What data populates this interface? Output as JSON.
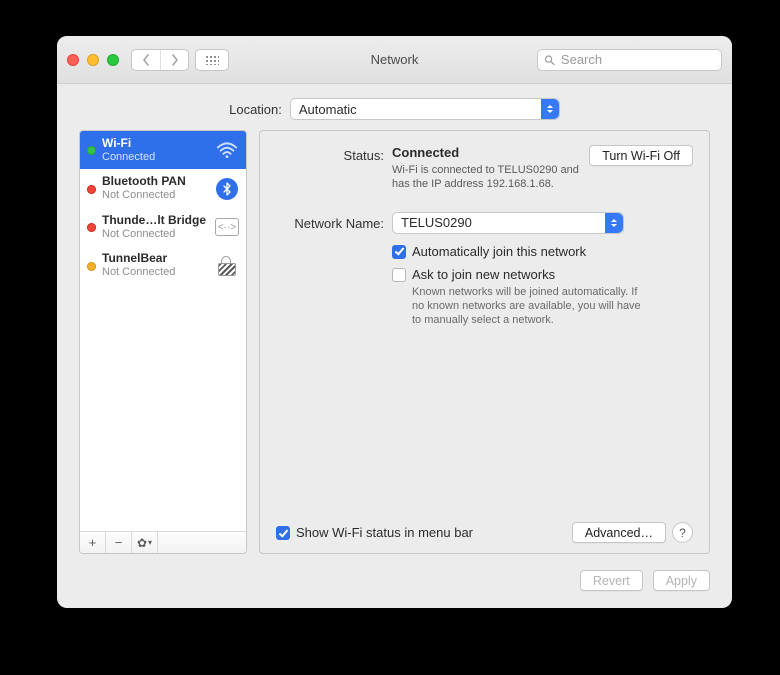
{
  "window": {
    "title": "Network"
  },
  "toolbar": {
    "search_placeholder": "Search"
  },
  "location": {
    "label": "Location:",
    "value": "Automatic"
  },
  "sidebar": {
    "services": [
      {
        "name": "Wi-Fi",
        "status": "Connected",
        "dot": "green",
        "icon": "wifi",
        "selected": true
      },
      {
        "name": "Bluetooth PAN",
        "status": "Not Connected",
        "dot": "red",
        "icon": "bluetooth",
        "selected": false
      },
      {
        "name": "Thunde…lt Bridge",
        "status": "Not Connected",
        "dot": "red",
        "icon": "tbridge",
        "selected": false
      },
      {
        "name": "TunnelBear",
        "status": "Not Connected",
        "dot": "amber",
        "icon": "lock",
        "selected": false
      }
    ]
  },
  "detail": {
    "status_label": "Status:",
    "status_value": "Connected",
    "turn_off_label": "Turn Wi-Fi Off",
    "status_desc": "Wi-Fi is connected to TELUS0290 and has the IP address 192.168.1.68.",
    "network_name_label": "Network Name:",
    "network_name_value": "TELUS0290",
    "auto_join_label": "Automatically join this network",
    "auto_join_checked": true,
    "ask_join_label": "Ask to join new networks",
    "ask_join_checked": false,
    "ask_join_help": "Known networks will be joined automatically. If no known networks are available, you will have to manually select a network.",
    "show_menu_label": "Show Wi-Fi status in menu bar",
    "show_menu_checked": true,
    "advanced_label": "Advanced…"
  },
  "footer": {
    "revert": "Revert",
    "apply": "Apply"
  }
}
